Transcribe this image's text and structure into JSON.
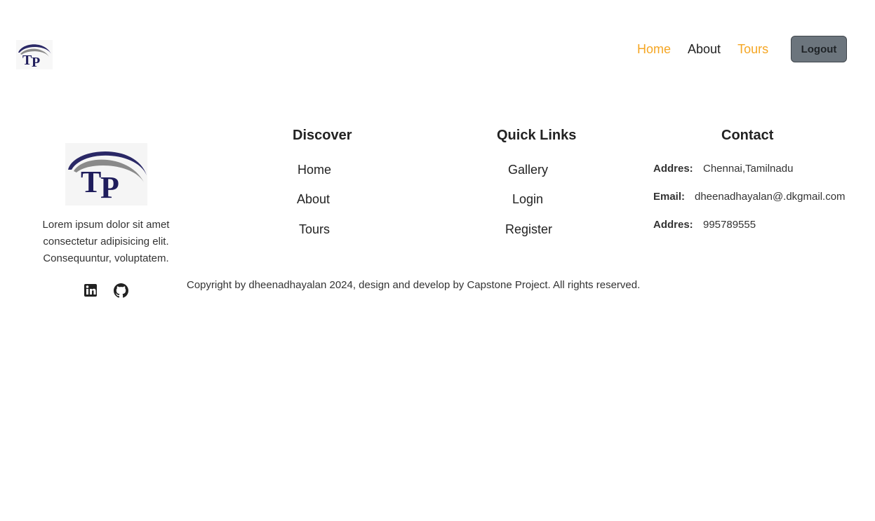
{
  "header": {
    "logo_text": "TP",
    "nav": [
      {
        "label": "Home",
        "color": "#f5a623"
      },
      {
        "label": "About",
        "color": "#222222"
      },
      {
        "label": "Tours",
        "color": "#f5a623"
      }
    ],
    "logout_label": "Logout"
  },
  "footer": {
    "logo_text": "TP",
    "description": "Lorem ipsum dolor sit amet consectetur adipisicing elit. Consequuntur, voluptatem.",
    "social": [
      "linkedin-icon",
      "github-icon"
    ],
    "discover": {
      "title": "Discover",
      "links": [
        "Home",
        "About",
        "Tours"
      ]
    },
    "quick_links": {
      "title": "Quick Links",
      "links": [
        "Gallery",
        "Login",
        "Register"
      ]
    },
    "contact": {
      "title": "Contact",
      "items": [
        {
          "label": "Addres:",
          "value": "Chennai,Tamilnadu"
        },
        {
          "label": "Email:",
          "value": "dheenadhayalan@.dkgmail.com"
        },
        {
          "label": "Addres:",
          "value": "995789555"
        }
      ]
    },
    "copyright": "Copyright by dheenadhayalan 2024, design and develop by Capstone Project. All rights reserved."
  }
}
